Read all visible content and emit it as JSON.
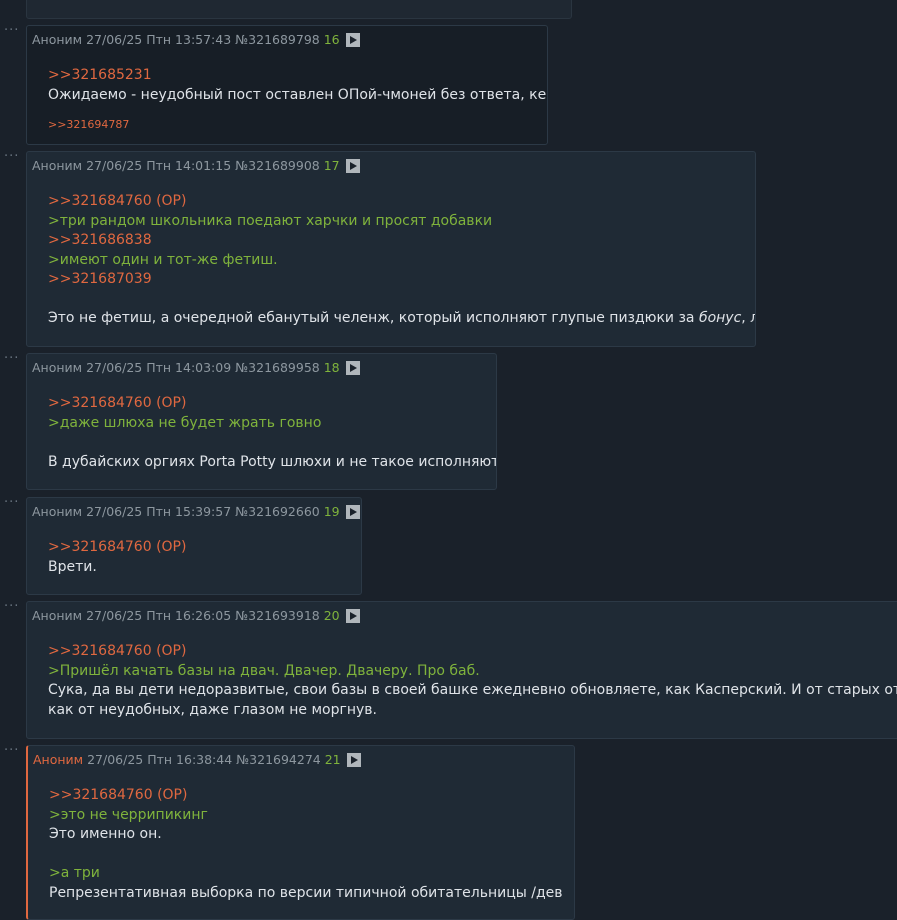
{
  "posts": [
    {
      "meta": {
        "name": "Аноним",
        "date": "27/06/25 Птн 13:57:43",
        "id": "№321689798",
        "num": "16"
      },
      "lines": [
        {
          "type": "ref",
          "text": ">>321685231"
        },
        {
          "type": "txt",
          "text": "Ожидаемо - неудобный пост оставлен ОПой-чмоней без ответа, кек."
        }
      ],
      "replies": ">>321694787"
    },
    {
      "meta": {
        "name": "Аноним",
        "date": "27/06/25 Птн 14:01:15",
        "id": "№321689908",
        "num": "17"
      },
      "lines": [
        {
          "type": "ref",
          "text": ">>321684760 (OP)"
        },
        {
          "type": "quote",
          "text": ">три рандом школьника поедают харчки и просят добавки"
        },
        {
          "type": "ref",
          "text": ">>321686838"
        },
        {
          "type": "quote",
          "text": ">имеют один и тот-же фетиш."
        },
        {
          "type": "ref",
          "text": ">>321687039"
        },
        {
          "type": "blank",
          "text": ""
        },
        {
          "type": "txt",
          "text": "Это не фетиш, а очередной ебанутый челенж, который исполняют глупые пиздюки за ",
          "em": "бонус",
          "after": ", лол."
        }
      ]
    },
    {
      "meta": {
        "name": "Аноним",
        "date": "27/06/25 Птн 14:03:09",
        "id": "№321689958",
        "num": "18"
      },
      "lines": [
        {
          "type": "ref",
          "text": ">>321684760 (OP)"
        },
        {
          "type": "quote",
          "text": ">даже шлюха не будет жрать говно"
        },
        {
          "type": "blank",
          "text": ""
        },
        {
          "type": "txt",
          "text": "В дубайских оргиях Porta Potty шлюхи и не такое исполняют."
        }
      ]
    },
    {
      "meta": {
        "name": "Аноним",
        "date": "27/06/25 Птн 15:39:57",
        "id": "№321692660",
        "num": "19"
      },
      "lines": [
        {
          "type": "ref",
          "text": ">>321684760 (OP)"
        },
        {
          "type": "txt",
          "text": "Врети."
        }
      ]
    },
    {
      "meta": {
        "name": "Аноним",
        "date": "27/06/25 Птн 16:26:05",
        "id": "№321693918",
        "num": "20"
      },
      "lines": [
        {
          "type": "ref",
          "text": ">>321684760 (OP)"
        },
        {
          "type": "quote",
          "text": ">Пришёл качать базы на двач. Двачер. Двачеру. Про баб."
        },
        {
          "type": "txt",
          "text": "Сука, да вы дети недоразвитые, свои базы в своей башке ежедневно обновляете, как Касперский. И от старых открещиваетесь,"
        },
        {
          "type": "txt",
          "text": "как от неудобных, даже глазом не моргнув."
        }
      ]
    },
    {
      "meta": {
        "name": "Аноним",
        "date": "27/06/25 Птн 16:38:44",
        "id": "№321694274",
        "num": "21"
      },
      "lines": [
        {
          "type": "ref",
          "text": ">>321684760 (OP)"
        },
        {
          "type": "quote",
          "text": ">это не черрипикинг"
        },
        {
          "type": "txt",
          "text": "Это именно он."
        },
        {
          "type": "blank",
          "text": ""
        },
        {
          "type": "quote",
          "text": ">а три"
        },
        {
          "type": "txt",
          "text": "Репрезентативная выборка по версии типичной обитательницы /дев"
        }
      ]
    }
  ]
}
